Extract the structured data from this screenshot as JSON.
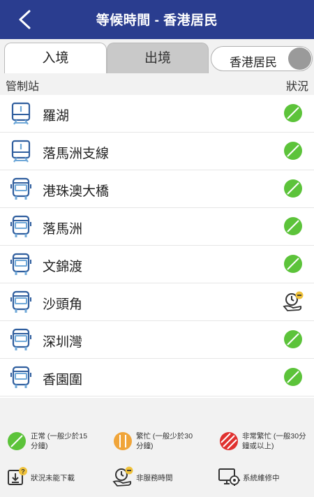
{
  "header": {
    "title": "等候時間 - 香港居民",
    "back_icon": "chevron-left-icon"
  },
  "tabs": {
    "entry": "入境",
    "exit": "出境"
  },
  "toggle": {
    "label": "香港居民"
  },
  "columns": {
    "station": "管制站",
    "status": "狀況"
  },
  "stations": [
    {
      "name": "羅湖",
      "icon": "train-icon",
      "status": "normal"
    },
    {
      "name": "落馬洲支線",
      "icon": "train-icon",
      "status": "normal"
    },
    {
      "name": "港珠澳大橋",
      "icon": "bus-icon",
      "status": "normal"
    },
    {
      "name": "落馬洲",
      "icon": "bus-icon",
      "status": "normal"
    },
    {
      "name": "文錦渡",
      "icon": "bus-icon",
      "status": "normal"
    },
    {
      "name": "沙頭角",
      "icon": "bus-icon",
      "status": "non-service-hours"
    },
    {
      "name": "深圳灣",
      "icon": "bus-icon",
      "status": "normal"
    },
    {
      "name": "香園圍",
      "icon": "bus-icon",
      "status": "normal"
    }
  ],
  "legend": {
    "normal_1": "正常 (一般少於15",
    "normal_2": "分鐘)",
    "busy_1": "繁忙 (一般少於30",
    "busy_2": "分鐘)",
    "very_busy_1": "非常繁忙 (一般30分",
    "very_busy_2": "鐘或以上)",
    "unavailable": "狀況未能下載",
    "non_service": "非服務時間",
    "maintenance": "系統維修中"
  },
  "colors": {
    "header": "#2a3d8f",
    "normal": "#5cc33a",
    "busy": "#f0a53a",
    "very_busy": "#e0312f",
    "icon_blue": "#2f5e9e"
  }
}
